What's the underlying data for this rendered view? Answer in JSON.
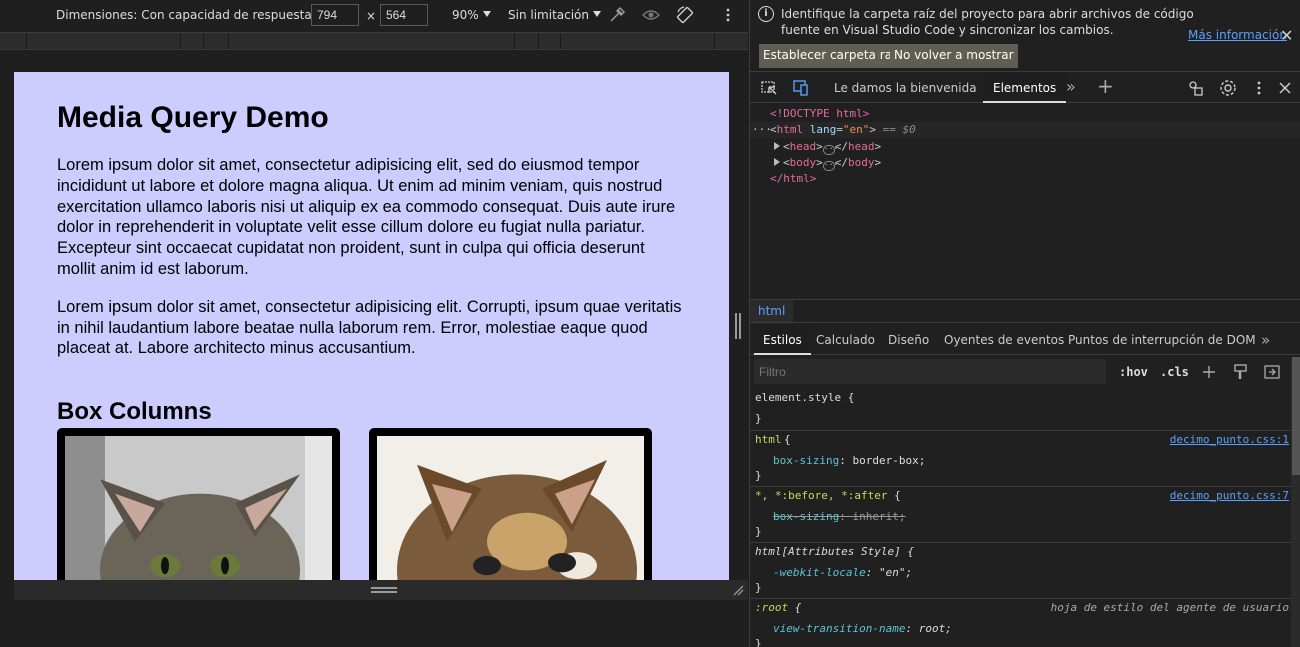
{
  "device_toolbar": {
    "dimensions_label": "Dimensiones: Con capacidad de respuesta",
    "width_value": "794",
    "times_label": "×",
    "height_value": "564",
    "zoom_label": "90%",
    "throttle_label": "Sin limitación"
  },
  "page": {
    "h1": "Media Query Demo",
    "p1": "Lorem ipsum dolor sit amet, consectetur adipisicing elit, sed do eiusmod tempor incididunt ut labore et dolore magna aliqua. Ut enim ad minim veniam, quis nostrud exercitation ullamco laboris nisi ut aliquip ex ea commodo consequat. Duis aute irure dolor in reprehenderit in voluptate velit esse cillum dolore eu fugiat nulla pariatur. Excepteur sint occaecat cupidatat non proident, sunt in culpa qui officia deserunt mollit anim id est laborum.",
    "p2": "Lorem ipsum dolor sit amet, consectetur adipisicing elit. Corrupti, ipsum quae veritatis in nihil laudantium labore beatae nulla laborum rem. Error, molestiae eaque quod placeat at. Labore architecto minus accusantium.",
    "h2": "Box Columns",
    "background_color": "#ccccff"
  },
  "infobar": {
    "message": "Identifique la carpeta raíz del proyecto para abrir archivos de código fuente en Visual Studio Code y sincronizar los cambios.",
    "link": "Más información",
    "btn_set_root": "Establecer carpeta raíz",
    "btn_dont_show": "No volver a mostrar"
  },
  "tabs": {
    "welcome": "Le damos la bienvenida",
    "elements": "Elementos"
  },
  "dom": {
    "doctype": "<!DOCTYPE html>",
    "html_open_tag": "html",
    "lang_attr": "lang",
    "lang_value": "\"en\"",
    "selected_marker": "== $0",
    "head": "head",
    "body": "body",
    "html_close": "</html>"
  },
  "breadcrumb": "html",
  "subtabs": {
    "styles": "Estilos",
    "computed": "Calculado",
    "layout": "Diseño",
    "listeners": "Oyentes de eventos",
    "dom_breakpoints": "Puntos de interrupción de DOM"
  },
  "filter": {
    "placeholder": "Filtro",
    "hov": ":hov",
    "cls": ".cls"
  },
  "styles": {
    "element_style": "element.style {",
    "close": "}",
    "r1_selector": "html",
    "r1_source": "decimo_punto.css:1",
    "r1_prop": "box-sizing",
    "r1_value": "border-box;",
    "r2_selector": "*, *:before, *:after",
    "r2_source": "decimo_punto.css:7",
    "r2_prop": "box-sizing",
    "r2_value": "inherit;",
    "r3_selector": "html[Attributes Style]",
    "r3_prop": "-webkit-locale",
    "r3_value": "\"en\";",
    "r4_selector": ":root",
    "r4_source": "hoja de estilo del agente de usuario",
    "r4_prop": "view-transition-name",
    "r4_value": "root;"
  },
  "colors": {
    "accent_link": "#5aa0ff",
    "tag": "#e36b9f",
    "selector": "#c0dc5a"
  }
}
